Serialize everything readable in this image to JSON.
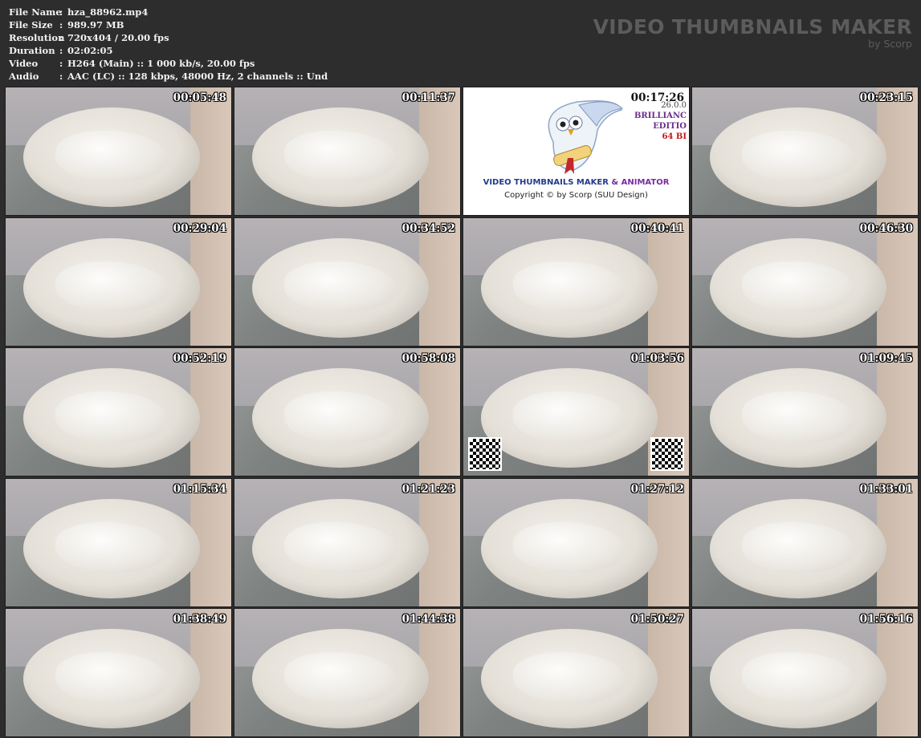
{
  "info": {
    "rows": [
      {
        "key": "File Name",
        "value": "hza_88962.mp4"
      },
      {
        "key": "File Size",
        "value": "989.97 MB"
      },
      {
        "key": "Resolution",
        "value": "720x404 / 20.00 fps"
      },
      {
        "key": "Duration",
        "value": "02:02:05"
      },
      {
        "key": "Video",
        "value": "H264 (Main) :: 1 000 kb/s, 20.00 fps"
      },
      {
        "key": "Audio",
        "value": "AAC (LC) :: 128 kbps, 48000 Hz, 2 channels :: Und"
      }
    ],
    "separator": ":"
  },
  "brand": {
    "title": "VIDEO THUMBNAILS MAKER",
    "subtitle": "by Scorp"
  },
  "logo": {
    "title_part1": "VIDEO THUMBNAILS MAKER",
    "title_amp": "&",
    "title_part2": "ANIMATOR",
    "copyright": "Copyright © by Scorp (SUU Design)",
    "version": "26.0.0",
    "edition_line1": "BRILLIANC",
    "edition_line2": "EDITIO",
    "bits": "64 BI"
  },
  "thumbnails": [
    {
      "time": "00:05:48"
    },
    {
      "time": "00:11:37"
    },
    {
      "time": "00:17:26",
      "logo": true
    },
    {
      "time": "00:23:15"
    },
    {
      "time": "00:29:04"
    },
    {
      "time": "00:34:52"
    },
    {
      "time": "00:40:41"
    },
    {
      "time": "00:46:30"
    },
    {
      "time": "00:52:19"
    },
    {
      "time": "00:58:08"
    },
    {
      "time": "01:03:56",
      "qr": true
    },
    {
      "time": "01:09:45"
    },
    {
      "time": "01:15:34"
    },
    {
      "time": "01:21:23"
    },
    {
      "time": "01:27:12"
    },
    {
      "time": "01:33:01"
    },
    {
      "time": "01:38:49"
    },
    {
      "time": "01:44:38"
    },
    {
      "time": "01:50:27"
    },
    {
      "time": "01:56:16"
    }
  ]
}
